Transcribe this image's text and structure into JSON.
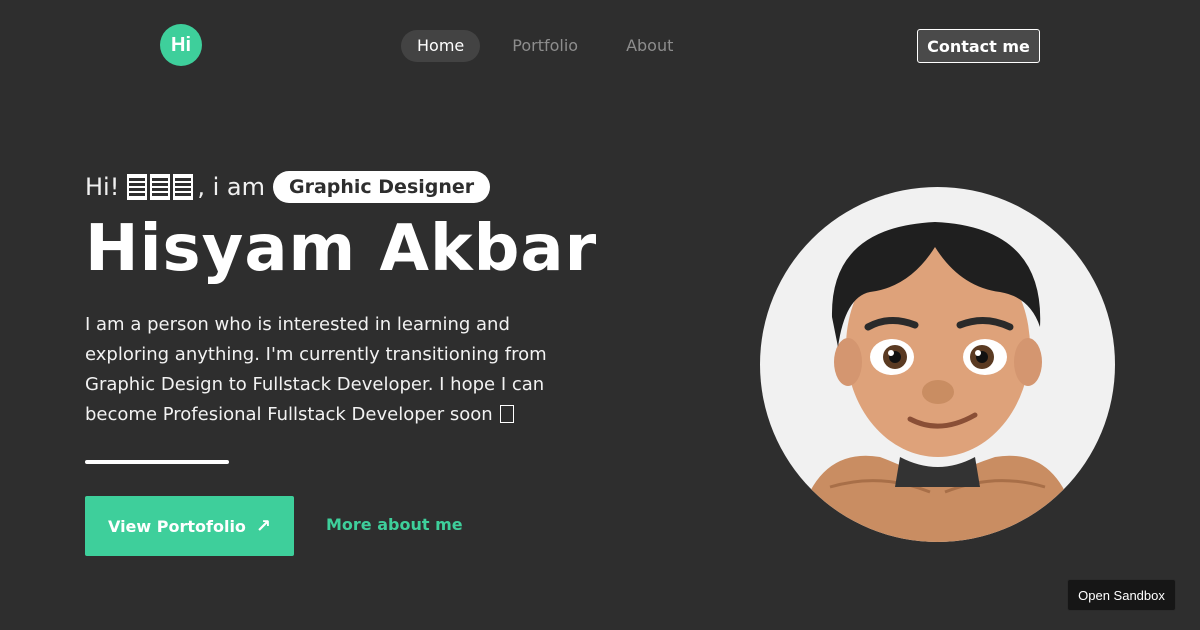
{
  "header": {
    "logo_text": "Hi",
    "nav": [
      {
        "label": "Home",
        "active": true
      },
      {
        "label": "Portfolio",
        "active": false
      },
      {
        "label": "About",
        "active": false
      }
    ],
    "contact_label": "Contact me"
  },
  "hero": {
    "greeting_prefix": "Hi!",
    "greeting_suffix": ", i am",
    "role": "Graphic Designer",
    "name": "Hisyam Akbar",
    "bio": "I am a person who is interested in learning and exploring anything. I'm currently transitioning from Graphic Design to Fullstack Developer. I hope I can become Profesional Fullstack Developer soon",
    "cta_label": "View Portofolio",
    "cta_icon": "arrow-up-right-icon",
    "more_label": "More about me"
  },
  "avatar_icon": "memoji-avatar",
  "sandbox_label": "Open Sandbox",
  "colors": {
    "background": "#2e2e2e",
    "accent": "#3ecf9b",
    "nav_active_bg": "#434343",
    "nav_inactive": "#8d8d8d"
  }
}
